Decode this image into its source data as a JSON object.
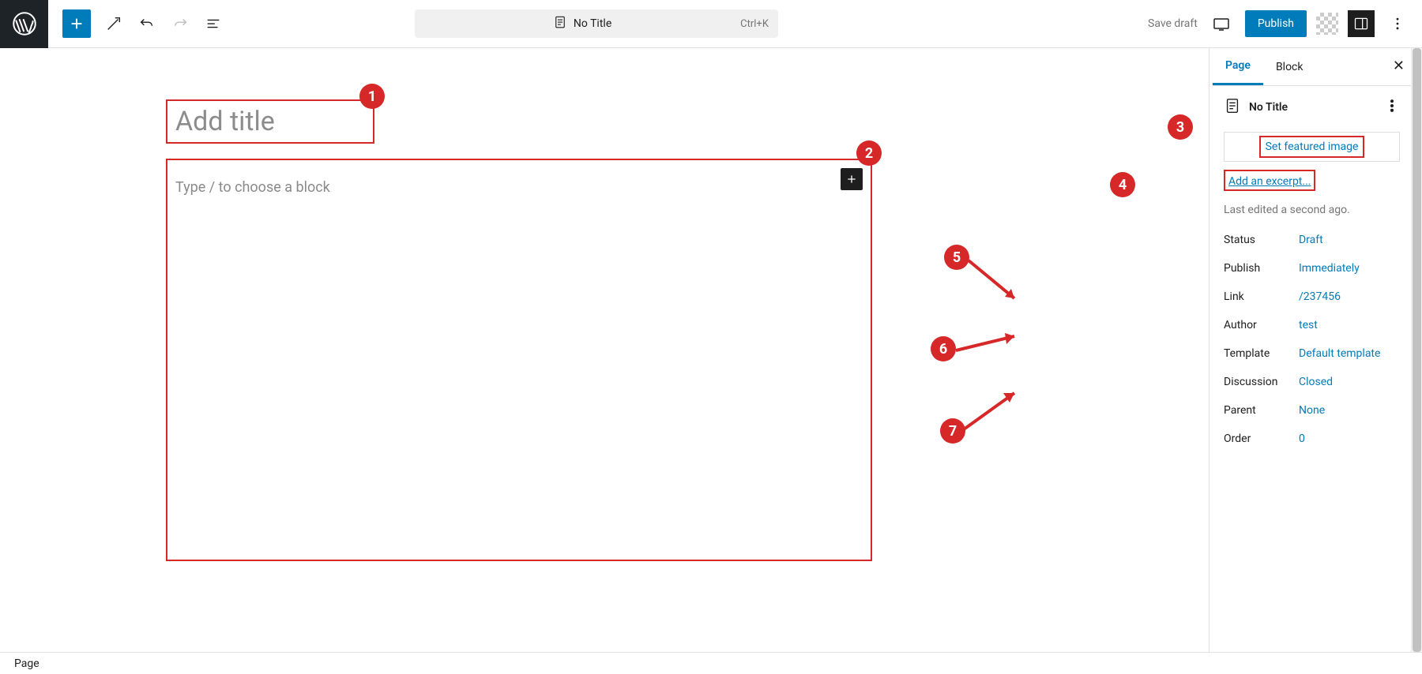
{
  "topbar": {
    "center_title": "No Title",
    "shortcut": "Ctrl+K",
    "save_draft": "Save draft",
    "publish": "Publish"
  },
  "editor": {
    "title_placeholder": "Add title",
    "content_placeholder": "Type / to choose a block"
  },
  "sidebar": {
    "tabs": {
      "page": "Page",
      "block": "Block"
    },
    "doc_title": "No Title",
    "featured_image": "Set featured image",
    "add_excerpt": "Add an excerpt...",
    "last_edited": "Last edited a second ago.",
    "meta": {
      "status": {
        "label": "Status",
        "value": "Draft"
      },
      "publish": {
        "label": "Publish",
        "value": "Immediately"
      },
      "link": {
        "label": "Link",
        "value": "/237456"
      },
      "author": {
        "label": "Author",
        "value": "test"
      },
      "template": {
        "label": "Template",
        "value": "Default template"
      },
      "discussion": {
        "label": "Discussion",
        "value": "Closed"
      },
      "parent": {
        "label": "Parent",
        "value": "None"
      },
      "order": {
        "label": "Order",
        "value": "0"
      }
    }
  },
  "statusbar": {
    "breadcrumb": "Page"
  },
  "annotations": {
    "b1": "1",
    "b2": "2",
    "b3": "3",
    "b4": "4",
    "b5": "5",
    "b6": "6",
    "b7": "7"
  }
}
